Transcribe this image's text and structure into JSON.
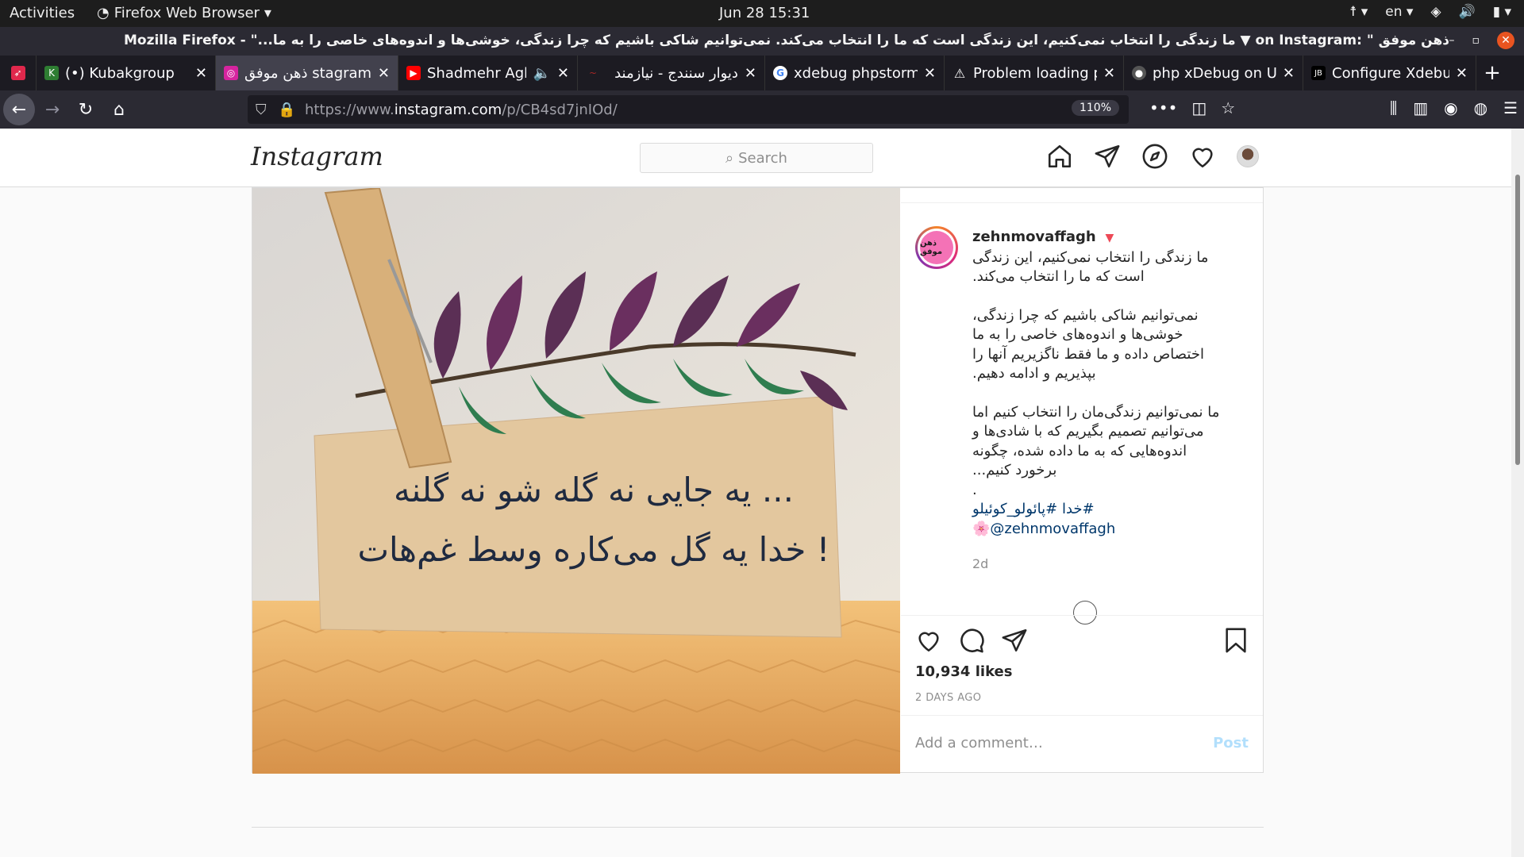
{
  "system": {
    "activities": "Activities",
    "app_name": "Firefox Web Browser",
    "clock": "Jun 28  15:31",
    "lang": "en"
  },
  "window": {
    "title": "ذهن موفق on Instagram: \"‎ ▼ ما زندگی را انتخاب نمی‌کنیم، این زندگی است که ما را انتخاب می‌کند. نمی‌توانیم شاکی باشیم که چرا زندگی، خوشی‌ها و اندوه‌های خاصی را به ما...\" - Mozilla Firefox"
  },
  "tabs": [
    {
      "label": "",
      "icon": "rocket-icon",
      "color": "#e0284c"
    },
    {
      "label": "(•) Kubakgroup",
      "icon": "kubak-icon",
      "color": "#2e7d32"
    },
    {
      "label": "ذهن موفق  stagram",
      "icon": "instagram-icon",
      "color": "#d6249f",
      "active": true
    },
    {
      "label": "Shadmehr Aghil",
      "icon": "youtube-icon",
      "color": "#ff0000",
      "audio": true
    },
    {
      "label": "دیوار سنندج - نیازمند",
      "icon": "divar-icon",
      "color": "#a62626"
    },
    {
      "label": "xdebug phpstorm",
      "icon": "google-icon",
      "color": "#4285f4"
    },
    {
      "label": "Problem loading p",
      "icon": "warning-icon",
      "color": "#ffffff"
    },
    {
      "label": "php xDebug on Ub",
      "icon": "github-icon",
      "color": "#555555"
    },
    {
      "label": "Configure Xdebug",
      "icon": "jetbrains-icon",
      "color": "#000000"
    }
  ],
  "navbar": {
    "url_prefix": "https://www.",
    "url_host": "instagram.com",
    "url_path": "/p/CB4sd7jnIOd/",
    "zoom": "110%"
  },
  "instagram": {
    "logo": "Instagram",
    "search_placeholder": "Search",
    "post": {
      "username": "zehnmovaffagh",
      "avatar_text": "ذهن موفق",
      "caption_p1": "ما زندگی را انتخاب نمی‌کنیم، این زندگی\nاست که ما را انتخاب می‌کند.",
      "caption_p2": "نمی‌توانیم شاکی باشیم که چرا زندگی،\nخوشی‌ها و اندوه‌های خاصی را به ما\nاختصاص داده و ما فقط ناگزیریم آنها را\nبپذیریم و ادامه دهیم.",
      "caption_p3": "ما نمی‌توانیم زندگی‌مان را انتخاب کنیم اما\nمی‌توانیم تصمیم بگیریم که با شادی‌ها و\nاندوه‌هایی که به ما داده شده، چگونه\nبرخورد کنیم...",
      "dot": ".",
      "hashtags": "#خدا #پائولو_کوئیلو",
      "mention": "🌸@zehnmovaffagh",
      "caption_time": "2d",
      "likes": "10,934 likes",
      "posted": "2 DAYS AGO",
      "comment_placeholder": "Add a comment…",
      "post_button": "Post",
      "photo_text_line1": "یه جایی نه گله شو نه گلنه ...",
      "photo_text_line2": "خدا یه گل می‌کاره وسط غم‌هات !"
    }
  }
}
